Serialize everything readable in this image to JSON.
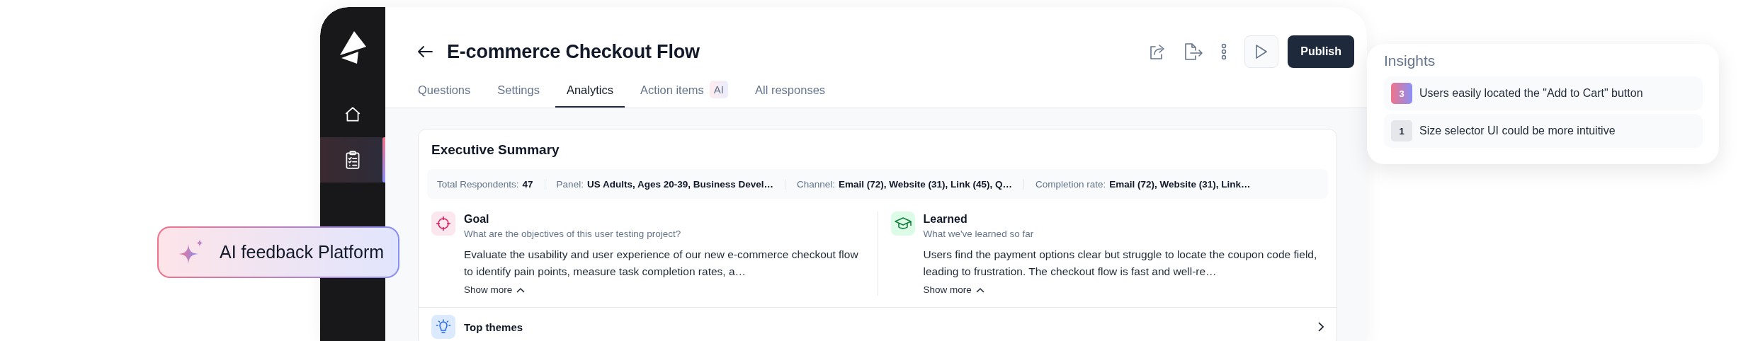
{
  "sidebar": {
    "items": [
      {
        "kind": "home",
        "selected": false
      },
      {
        "kind": "clipboard",
        "selected": true
      }
    ]
  },
  "header": {
    "title": "E-commerce Checkout Flow",
    "publish": "Publish"
  },
  "tabs": [
    {
      "label": "Questions",
      "selected": false
    },
    {
      "label": "Settings",
      "selected": false
    },
    {
      "label": "Analytics",
      "selected": true
    },
    {
      "label": "Action items",
      "selected": false,
      "badge": "AI"
    },
    {
      "label": "All responses",
      "selected": false
    }
  ],
  "summary": {
    "title": "Executive Summary",
    "stats": [
      {
        "label": "Total Respondents:",
        "value": "47"
      },
      {
        "label": "Panel:",
        "value": "US Adults, Ages 20-39, Business Devel…"
      },
      {
        "label": "Channel:",
        "value": "Email (72), Website (31), Link (45), Q…"
      },
      {
        "label": "Completion rate:",
        "value": "Email (72), Website (31), Link…"
      }
    ],
    "sections": [
      {
        "kind": "goal",
        "title": "Goal",
        "subtitle": "What are the objectives of this user testing project?",
        "text": "Evaluate the usability and user experience of our new e-commerce checkout flow to identify pain points, measure task completion rates, a…",
        "toggle": "Show more"
      },
      {
        "kind": "learned",
        "title": "Learned",
        "subtitle": "What we've learned so far",
        "text": "Users find the payment options clear but struggle to locate the coupon code field, leading to frustration. The checkout flow is fast and well-re…",
        "toggle": "Show more"
      }
    ],
    "themes": {
      "title": "Top themes"
    }
  },
  "insights": {
    "title": "Insights",
    "items": [
      {
        "count": "3",
        "text": "Users easily located the \"Add to Cart\" button",
        "highlighted": true
      },
      {
        "count": "1",
        "text": "Size selector UI could be more intuitive",
        "highlighted": false
      }
    ]
  },
  "feature_badge": {
    "label": "AI feedback Platform"
  }
}
